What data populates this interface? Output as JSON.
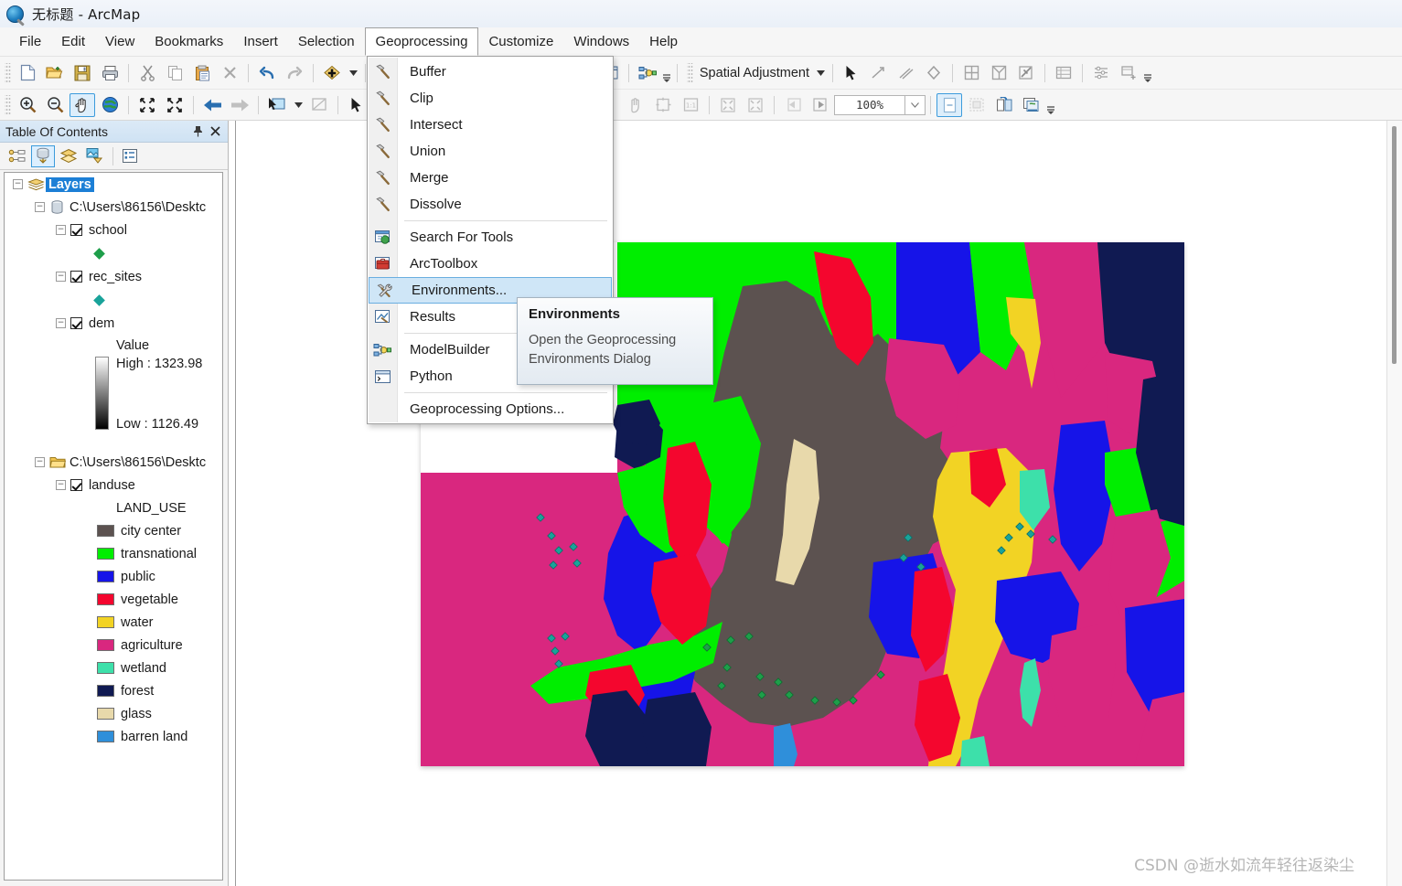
{
  "window": {
    "title": "无标题 - ArcMap",
    "app_icon": "arcmap-icon"
  },
  "menubar": {
    "items": [
      {
        "label": "File",
        "active": false
      },
      {
        "label": "Edit",
        "active": false
      },
      {
        "label": "View",
        "active": false
      },
      {
        "label": "Bookmarks",
        "active": false
      },
      {
        "label": "Insert",
        "active": false
      },
      {
        "label": "Selection",
        "active": false
      },
      {
        "label": "Geoprocessing",
        "active": true
      },
      {
        "label": "Customize",
        "active": false
      },
      {
        "label": "Windows",
        "active": false
      },
      {
        "label": "Help",
        "active": false
      }
    ]
  },
  "geoprocessing_menu": {
    "items": [
      {
        "label": "Buffer",
        "icon": "hammer-tool-icon",
        "highlighted": false,
        "separator_after": false
      },
      {
        "label": "Clip",
        "icon": "hammer-tool-icon",
        "highlighted": false,
        "separator_after": false
      },
      {
        "label": "Intersect",
        "icon": "hammer-tool-icon",
        "highlighted": false,
        "separator_after": false
      },
      {
        "label": "Union",
        "icon": "hammer-tool-icon",
        "highlighted": false,
        "separator_after": false
      },
      {
        "label": "Merge",
        "icon": "hammer-tool-icon",
        "highlighted": false,
        "separator_after": false
      },
      {
        "label": "Dissolve",
        "icon": "hammer-tool-icon",
        "highlighted": false,
        "separator_after": true
      },
      {
        "label": "Search For Tools",
        "icon": "search-window-icon",
        "highlighted": false,
        "separator_after": false
      },
      {
        "label": "ArcToolbox",
        "icon": "arctoolbox-icon",
        "highlighted": false,
        "separator_after": false
      },
      {
        "label": "Environments...",
        "icon": "environments-wrench-icon",
        "highlighted": true,
        "separator_after": false
      },
      {
        "label": "Results",
        "icon": "results-icon",
        "highlighted": false,
        "separator_after": true
      },
      {
        "label": "ModelBuilder",
        "icon": "modelbuilder-icon",
        "highlighted": false,
        "separator_after": false
      },
      {
        "label": "Python",
        "icon": "python-window-icon",
        "highlighted": false,
        "separator_after": true
      },
      {
        "label": "Geoprocessing Options...",
        "icon": "none",
        "highlighted": false,
        "separator_after": false
      }
    ]
  },
  "tooltip": {
    "title": "Environments",
    "line1": "Open the Geoprocessing",
    "line2": "Environments Dialog"
  },
  "standard_toolbar": {
    "buttons": [
      {
        "name": "new-document-icon",
        "glyph": "new"
      },
      {
        "name": "open-folder-icon",
        "glyph": "open"
      },
      {
        "name": "save-icon",
        "glyph": "save"
      },
      {
        "name": "print-icon",
        "glyph": "print"
      },
      {
        "name": "cut-icon",
        "glyph": "cut"
      },
      {
        "name": "copy-icon",
        "glyph": "copy"
      },
      {
        "name": "paste-icon",
        "glyph": "paste"
      },
      {
        "name": "delete-icon",
        "glyph": "delete"
      },
      {
        "name": "undo-icon",
        "glyph": "undo"
      },
      {
        "name": "redo-icon",
        "glyph": "redo"
      },
      {
        "name": "add-data-icon",
        "glyph": "adddata"
      }
    ]
  },
  "tools_toolbar": {
    "buttons": [
      {
        "name": "zoom-in-icon",
        "selected": false
      },
      {
        "name": "zoom-out-icon",
        "selected": false
      },
      {
        "name": "pan-hand-icon",
        "selected": true
      },
      {
        "name": "full-extent-globe-icon",
        "selected": false
      },
      {
        "name": "fixed-zoom-in-icon",
        "selected": false
      },
      {
        "name": "fixed-zoom-out-icon",
        "selected": false
      },
      {
        "name": "go-back-extent-icon",
        "selected": false
      },
      {
        "name": "go-next-extent-icon",
        "selected": false
      },
      {
        "name": "select-features-icon",
        "selected": false
      },
      {
        "name": "clear-selection-icon",
        "selected": false
      },
      {
        "name": "select-elements-arrow-icon",
        "selected": false
      },
      {
        "name": "identify-info-icon",
        "selected": false
      }
    ]
  },
  "spatial_adjustment_toolbar": {
    "label": "Spatial Adjustment",
    "buttons": [
      {
        "name": "select-elements-arrow-icon"
      },
      {
        "name": "new-displacement-link-icon"
      },
      {
        "name": "new-multi-displacement-link-icon"
      },
      {
        "name": "new-identity-link-icon"
      },
      {
        "name": "edge-match-icon"
      },
      {
        "name": "edge-snap-icon"
      },
      {
        "name": "attribute-transfer-icon"
      },
      {
        "name": "view-link-table-icon"
      },
      {
        "name": "adjust-icon"
      },
      {
        "name": "transform-icon"
      }
    ]
  },
  "layout_toolbar": {
    "zoom_value": "100%",
    "buttons": [
      {
        "name": "layout-zoom-in-icon"
      },
      {
        "name": "layout-zoom-out-icon"
      },
      {
        "name": "layout-pan-icon"
      },
      {
        "name": "layout-full-extent-icon"
      },
      {
        "name": "layout-one-to-one-icon"
      },
      {
        "name": "layout-fixed-zoom-in-icon"
      },
      {
        "name": "layout-fixed-zoom-out-icon"
      },
      {
        "name": "layout-back-icon"
      },
      {
        "name": "layout-forward-icon"
      },
      {
        "name": "toggle-draft-mode-icon"
      },
      {
        "name": "focus-data-frame-icon"
      },
      {
        "name": "change-layout-icon"
      },
      {
        "name": "data-driven-pages-icon"
      }
    ]
  },
  "toc": {
    "title": "Table Of Contents",
    "pin_icon": "pin-icon",
    "close_icon": "close-icon",
    "toolbar": [
      {
        "name": "list-by-drawing-order-icon",
        "selected": false
      },
      {
        "name": "list-by-source-icon",
        "selected": true
      },
      {
        "name": "list-by-visibility-icon",
        "selected": false
      },
      {
        "name": "list-by-selection-icon",
        "selected": false
      },
      {
        "name": "options-icon",
        "selected": false
      }
    ],
    "root": "Layers",
    "groups": [
      {
        "path": "C:\\Users\\86156\\Desktc",
        "icon": "geodatabase-icon",
        "layers": [
          {
            "name": "school",
            "checked": true,
            "symbol_type": "point",
            "symbol_color": "#1e9e4a"
          },
          {
            "name": "rec_sites",
            "checked": true,
            "symbol_type": "point",
            "symbol_color": "#1b9b92"
          },
          {
            "name": "dem",
            "checked": true,
            "symbol_type": "ramp",
            "field_label": "Value",
            "high_label": "High : 1323.98",
            "low_label": "Low : 1126.49",
            "ramp_from": "#ffffff",
            "ramp_to": "#000000"
          }
        ]
      },
      {
        "path": "C:\\Users\\86156\\Desktc",
        "icon": "folder-icon",
        "layers": [
          {
            "name": "landuse",
            "checked": true,
            "symbol_type": "categories",
            "field_label": "LAND_USE",
            "classes": [
              {
                "label": "city center",
                "color": "#5c5250"
              },
              {
                "label": "transnational",
                "color": "#00ee00"
              },
              {
                "label": "public",
                "color": "#1614e8"
              },
              {
                "label": "vegetable",
                "color": "#f4062e"
              },
              {
                "label": "water",
                "color": "#f2d324"
              },
              {
                "label": "agriculture",
                "color": "#d9277f"
              },
              {
                "label": "wetland",
                "color": "#3de0aa"
              },
              {
                "label": "forest",
                "color": "#101a52"
              },
              {
                "label": "glass",
                "color": "#e8d9ab"
              },
              {
                "label": "barren land",
                "color": "#2f8fda"
              }
            ]
          }
        ]
      }
    ]
  },
  "map": {
    "background": "#d9277f",
    "point_marker_colors": {
      "school": "#1e9e4a",
      "rec_sites": "#19a39a"
    }
  },
  "watermark": {
    "text": "CSDN @逝水如流年轻往返染尘"
  }
}
